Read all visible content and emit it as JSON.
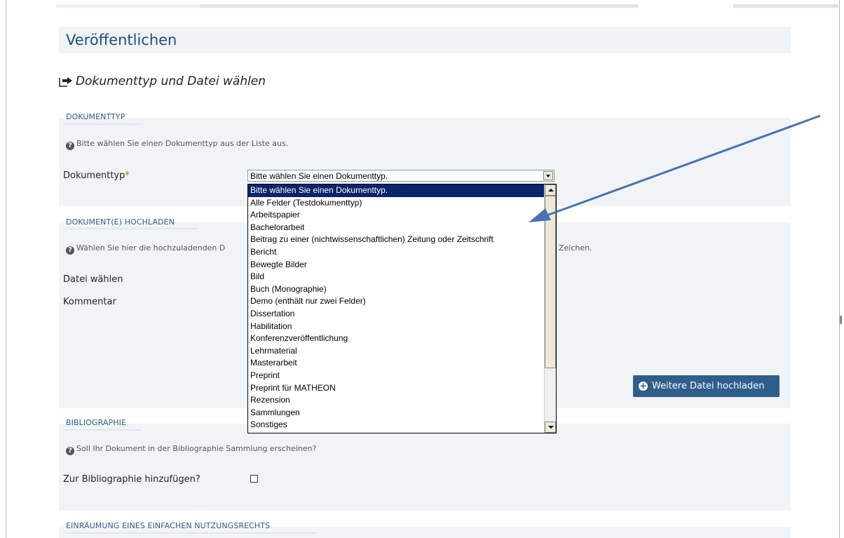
{
  "page_title": "Veröffentlichen",
  "section_heading": "Dokumenttyp und Datei wählen",
  "dokumenttyp": {
    "legend": "DOKUMENTTYP",
    "hint": "Bitte wählen Sie einen Dokumenttyp aus der Liste aus.",
    "label": "Dokumenttyp",
    "required_mark": "*",
    "selected_value": "Bitte wählen Sie einen Dokumenttyp.",
    "options": [
      "Bitte wählen Sie einen Dokumenttyp.",
      "Alle Felder (Testdokumenttyp)",
      "Arbeitspapier",
      "Bachelorarbeit",
      "Beitrag zu einer (nichtwissenschaftlichen) Zeitung oder Zeitschrift",
      "Bericht",
      "Bewegte Bilder",
      "Bild",
      "Buch (Monographie)",
      "Demo (enthält nur zwei Felder)",
      "Dissertation",
      "Habilitation",
      "Konferenzveröffentlichung",
      "Lehrmaterial",
      "Masterarbeit",
      "Preprint",
      "Preprint für MATHEON",
      "Rezension",
      "Sammlungen",
      "Sonstiges"
    ]
  },
  "upload": {
    "legend": "DOKUMENT(E) HOCHLADEN",
    "hint_start": "Wählen Sie hier die hochzuladenden D",
    "hint_end": "Zeichen.",
    "file_label": "Datei wählen",
    "comment_label": "Kommentar",
    "add_button": "Weitere Datei hochladen"
  },
  "bibliographie": {
    "legend": "BIBLIOGRAPHIE",
    "hint": "Soll Ihr Dokument in der Bibliographie Sammlung erscheinen?",
    "label": "Zur Bibliographie hinzufügen?",
    "checked": false
  },
  "nutzungsrecht": {
    "legend": "EINRÄUMUNG EINES EINFACHEN NUTZUNGSRECHTS"
  },
  "colors": {
    "title": "#1f4e79",
    "legend": "#2e5a87",
    "selection": "#0a246a",
    "button": "#2e5e8c",
    "annotation_arrow": "#4a72b0"
  },
  "icons": {
    "heading": "arrow-right-icon",
    "hint": "question-circle-icon",
    "button": "plus-circle-icon"
  }
}
